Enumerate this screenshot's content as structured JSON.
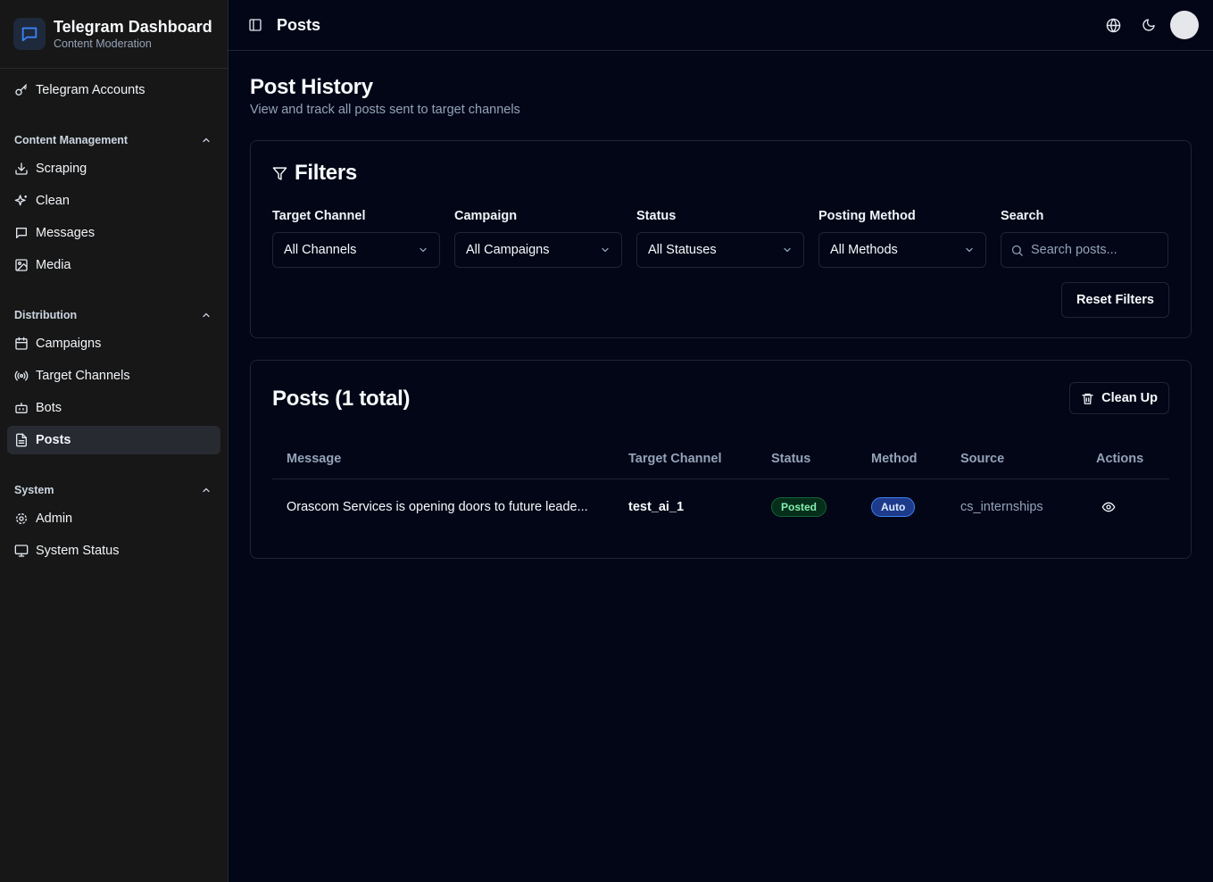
{
  "brand": {
    "title": "Telegram Dashboard",
    "subtitle": "Content Moderation"
  },
  "sidebar": {
    "top_items": [
      {
        "label": "Telegram Accounts",
        "icon": "key-icon"
      }
    ],
    "groups": [
      {
        "title": "Content Management",
        "items": [
          {
            "label": "Scraping",
            "icon": "download-icon"
          },
          {
            "label": "Clean",
            "icon": "sparkles-icon"
          },
          {
            "label": "Messages",
            "icon": "message-square-icon"
          },
          {
            "label": "Media",
            "icon": "image-icon"
          }
        ]
      },
      {
        "title": "Distribution",
        "items": [
          {
            "label": "Campaigns",
            "icon": "calendar-icon"
          },
          {
            "label": "Target Channels",
            "icon": "radio-icon"
          },
          {
            "label": "Bots",
            "icon": "bot-icon"
          },
          {
            "label": "Posts",
            "icon": "file-text-icon",
            "active": true
          }
        ]
      },
      {
        "title": "System",
        "items": [
          {
            "label": "Admin",
            "icon": "cog-icon"
          },
          {
            "label": "System Status",
            "icon": "monitor-icon"
          }
        ]
      }
    ]
  },
  "topbar": {
    "title": "Posts"
  },
  "page": {
    "title": "Post History",
    "subtitle": "View and track all posts sent to target channels"
  },
  "filters": {
    "title": "Filters",
    "fields": [
      {
        "label": "Target Channel",
        "value": "All Channels"
      },
      {
        "label": "Campaign",
        "value": "All Campaigns"
      },
      {
        "label": "Status",
        "value": "All Statuses"
      },
      {
        "label": "Posting Method",
        "value": "All Methods"
      }
    ],
    "search": {
      "label": "Search",
      "placeholder": "Search posts..."
    },
    "reset_label": "Reset Filters"
  },
  "posts": {
    "title": "Posts (1 total)",
    "cleanup_label": "Clean Up",
    "columns": [
      "Message",
      "Target Channel",
      "Status",
      "Method",
      "Source",
      "Actions"
    ],
    "rows": [
      {
        "message": "Orascom Services is opening doors to future leade...",
        "channel": "test_ai_1",
        "status": "Posted",
        "method": "Auto",
        "source": "cs_internships"
      }
    ]
  }
}
